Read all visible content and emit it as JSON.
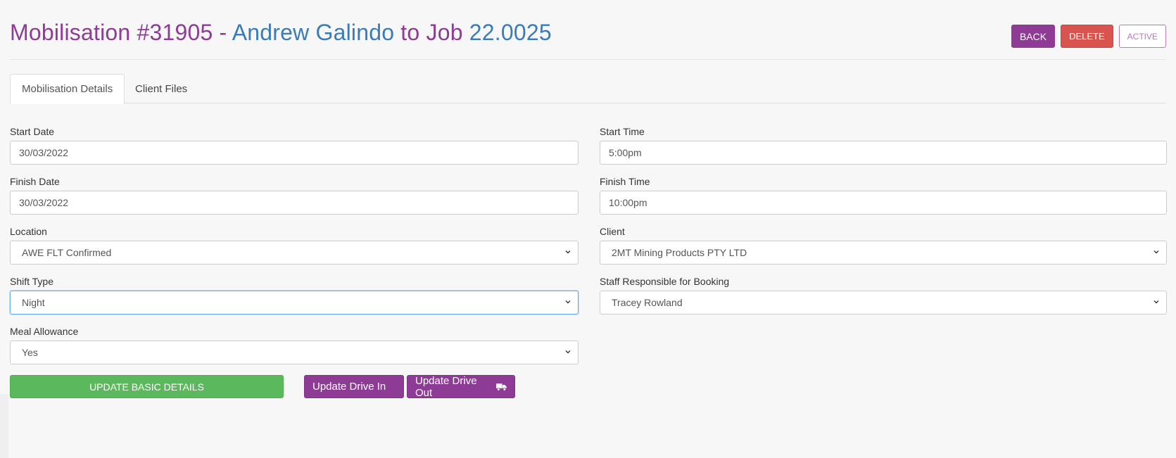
{
  "header": {
    "title_prefix": "Mobilisation #31905 - ",
    "title_name": "Andrew Galindo",
    "title_to": " to ",
    "title_job_word": "Job",
    "title_job_num": " 22.0025",
    "buttons": {
      "back": "BACK",
      "delete": "DELETE",
      "active": "ACTIVE"
    }
  },
  "tabs": [
    {
      "label": "Mobilisation Details",
      "active": true
    },
    {
      "label": "Client Files",
      "active": false
    }
  ],
  "form": {
    "start_date": {
      "label": "Start Date",
      "value": "30/03/2022"
    },
    "start_time": {
      "label": "Start Time",
      "value": "5:00pm"
    },
    "finish_date": {
      "label": "Finish Date",
      "value": "30/03/2022"
    },
    "finish_time": {
      "label": "Finish Time",
      "value": "10:00pm"
    },
    "location": {
      "label": "Location",
      "value": "AWE FLT Confirmed"
    },
    "client": {
      "label": "Client",
      "value": "2MT Mining Products PTY LTD"
    },
    "shift_type": {
      "label": "Shift Type",
      "value": "Night"
    },
    "staff": {
      "label": "Staff Responsible for Booking",
      "value": "Tracey Rowland"
    },
    "meal": {
      "label": "Meal Allowance",
      "value": "Yes"
    }
  },
  "actions": {
    "update_basic": "UPDATE BASIC DETAILS",
    "drive_in": "Update Drive In",
    "drive_out": "Update Drive Out"
  },
  "icons": {
    "select_arrow": "chevron-down-icon",
    "drive_out": "truck-icon"
  },
  "colors": {
    "brand_purple": "#8e3b96",
    "title_blue": "#3a7bb8",
    "success": "#5cb85c",
    "danger": "#d9534f"
  }
}
